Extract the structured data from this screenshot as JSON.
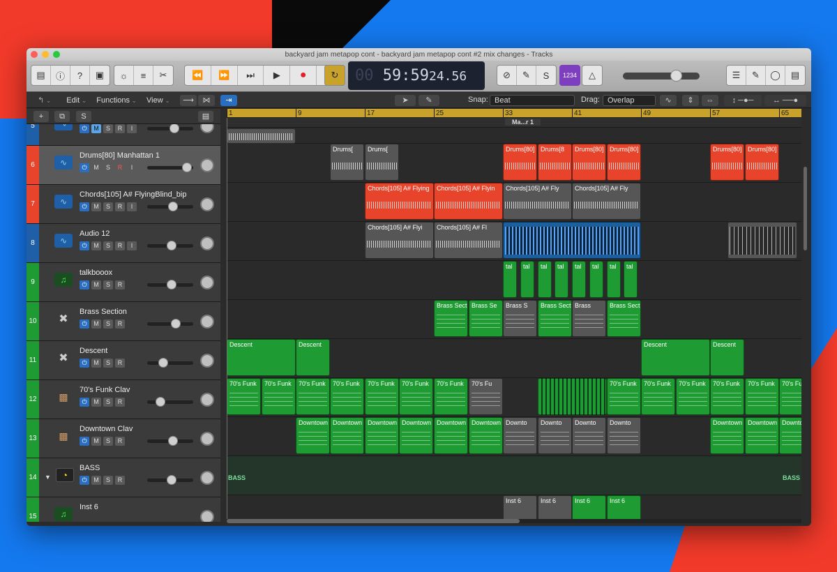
{
  "window": {
    "title": "backyard jam metapop cont - backyard jam metapop cont #2 mix changes - Tracks"
  },
  "transport": {
    "lcd_dim": "00",
    "lcd_time": "59:59",
    "lcd_ms": "24.56",
    "counter": "1234"
  },
  "toolbar2": {
    "edit": "Edit",
    "functions": "Functions",
    "view": "View",
    "snap_label": "Snap:",
    "snap_value": "Beat",
    "drag_label": "Drag:",
    "drag_value": "Overlap"
  },
  "header_buttons": {
    "add": "+",
    "s": "S"
  },
  "ruler": [
    "1",
    "9",
    "17",
    "25",
    "33",
    "41",
    "49",
    "57",
    "65"
  ],
  "marker": "Ma...r 1",
  "colors": {
    "red": "#e8432b",
    "green": "#1f9b33",
    "blue": "#2a6fbf",
    "ruler": "#c8a22a"
  },
  "tracks": [
    {
      "num": "5",
      "name": "",
      "icon": "waveform-icon",
      "color": "#1e5fa8",
      "buttons": [
        "M",
        "S",
        "R",
        "I"
      ]
    },
    {
      "num": "6",
      "name": "Drums[80] Manhattan 1",
      "icon": "waveform-icon",
      "color": "#e8432b",
      "buttons": [
        "M",
        "S",
        "R",
        "I"
      ]
    },
    {
      "num": "7",
      "name": "Chords[105] A# FlyingBlind_bip",
      "icon": "waveform-icon",
      "color": "#e8432b",
      "buttons": [
        "M",
        "S",
        "R",
        "I"
      ]
    },
    {
      "num": "8",
      "name": "Audio 12",
      "icon": "waveform-icon",
      "color": "#1e5fa8",
      "buttons": [
        "M",
        "S",
        "R",
        "I"
      ]
    },
    {
      "num": "9",
      "name": "talkbooox",
      "icon": "music-note-icon",
      "color": "#1f9b33",
      "buttons": [
        "M",
        "S",
        "R"
      ]
    },
    {
      "num": "10",
      "name": "Brass Section",
      "icon": "keyboard-stand-icon",
      "color": "#1f9b33",
      "buttons": [
        "M",
        "S",
        "R"
      ]
    },
    {
      "num": "11",
      "name": "Descent",
      "icon": "keyboard-stand-icon",
      "color": "#1f9b33",
      "buttons": [
        "M",
        "S",
        "R"
      ]
    },
    {
      "num": "12",
      "name": "70's Funk Clav",
      "icon": "keyboard-icon",
      "color": "#1f9b33",
      "buttons": [
        "M",
        "S",
        "R"
      ]
    },
    {
      "num": "13",
      "name": "Downtown Clav",
      "icon": "keyboard-icon",
      "color": "#1f9b33",
      "buttons": [
        "M",
        "S",
        "R"
      ]
    },
    {
      "num": "14",
      "name": "BASS",
      "icon": "track-stack-icon",
      "color": "#1f9b33",
      "buttons": [
        "M",
        "S",
        "R"
      ]
    },
    {
      "num": "15",
      "name": "Inst 6",
      "icon": "music-note-icon",
      "color": "#1f9b33",
      "buttons": []
    }
  ],
  "regions": {
    "r6a": "Drums[",
    "r6b": "Drums[",
    "r6c": "Drums[80]",
    "r6d": "Drums[8",
    "r6e": "Drums[80]",
    "r6f": "Drums[80]",
    "r6g": "Drums[80]",
    "r6h": "Drums[80]",
    "r7a": "Chords[105] A# Flying",
    "r7b": "Chords[105] A# Flyin",
    "r7c": "Chords[105] A# Fly",
    "r7d": "Chords[105] A# Fly",
    "r8a": "Chords[105] A# Flyi",
    "r8b": "Chords[105] A# Fl",
    "r9": "tal",
    "r10a": "Brass Sect",
    "r10b": "Brass Se",
    "r10c": "Brass S",
    "r10d": "Brass Sect",
    "r10e": "Brass",
    "r10f": "Brass Sect",
    "r11a": "Descent",
    "r11b": "Descent",
    "r11c": "Descent",
    "r11d": "Descent",
    "r12": "70's Funk",
    "r12g": "70's Fu",
    "r13": "Downtown",
    "r13g": "Downto",
    "r14": "BASS",
    "r15": "Inst 6"
  }
}
